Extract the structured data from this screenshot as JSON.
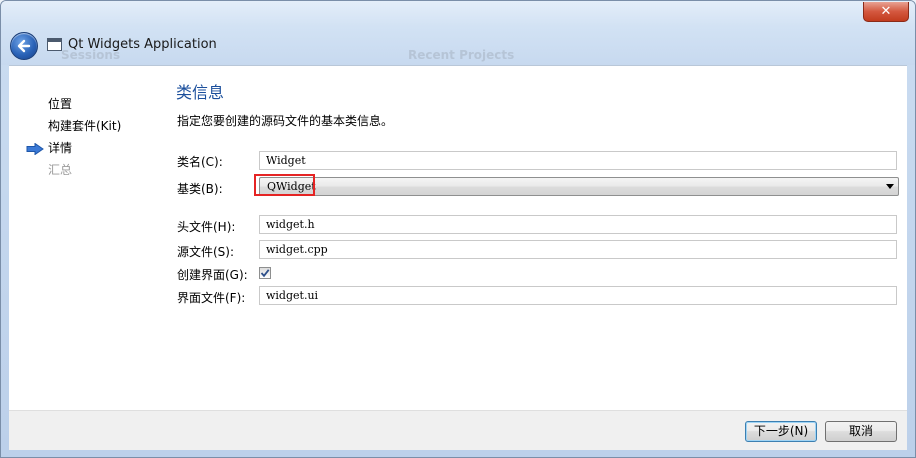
{
  "window": {
    "title": "Qt Widgets Application",
    "close_glyph": "✕",
    "ghost_left": "Sessions",
    "ghost_center": "Recent Projects",
    "back_icon": "back-arrow-icon"
  },
  "sidebar": {
    "items": [
      {
        "label": "位置",
        "state": "done"
      },
      {
        "label": "构建套件(Kit)",
        "state": "done"
      },
      {
        "label": "详情",
        "state": "current"
      },
      {
        "label": "汇总",
        "state": "pending"
      }
    ]
  },
  "page": {
    "title": "类信息",
    "description": "指定您要创建的源码文件的基本类信息。"
  },
  "form": {
    "class_name": {
      "label": "类名(C):",
      "value": "Widget"
    },
    "base_class": {
      "label": "基类(B):",
      "value": "QWidget"
    },
    "header_file": {
      "label": "头文件(H):",
      "value": "widget.h"
    },
    "source_file": {
      "label": "源文件(S):",
      "value": "widget.cpp"
    },
    "generate_form": {
      "label": "创建界面(G):",
      "checked": true
    },
    "form_file": {
      "label": "界面文件(F):",
      "value": "widget.ui"
    }
  },
  "buttons": {
    "next": "下一步(N)",
    "cancel": "取消"
  },
  "colors": {
    "accent": "#1b4f9c",
    "highlight": "#e52424",
    "current_arrow": "#3b79d6"
  }
}
